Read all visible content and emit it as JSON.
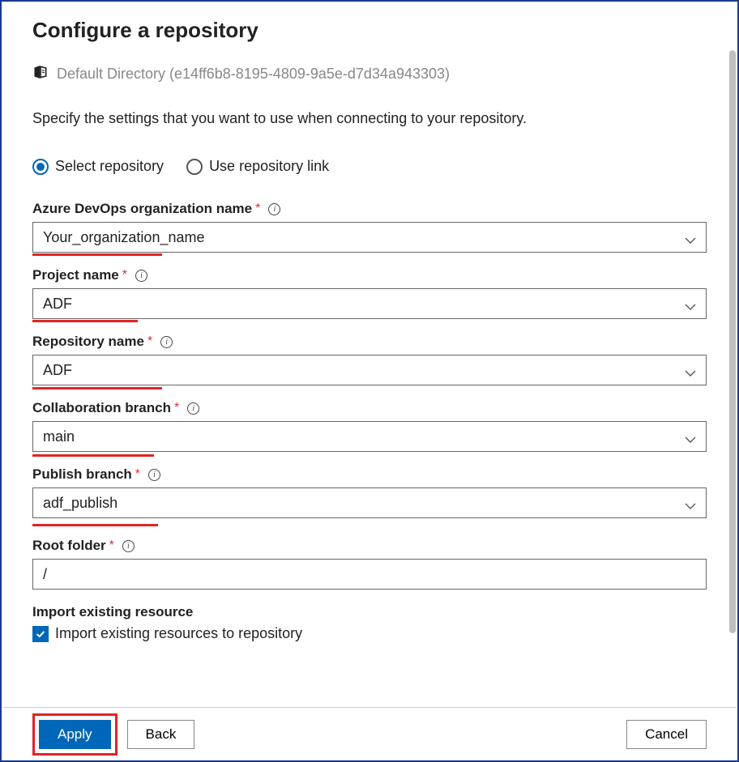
{
  "header": {
    "title": "Configure a repository",
    "breadcrumb": "Default Directory (e14ff6b8-8195-4809-9a5e-d7d34a943303)",
    "description": "Specify the settings that you want to use when connecting to your repository."
  },
  "radio": {
    "select_repository": "Select repository",
    "use_link": "Use repository link"
  },
  "fields": {
    "org": {
      "label": "Azure DevOps organization name",
      "value": "Your_organization_name"
    },
    "project": {
      "label": "Project name",
      "value": "ADF"
    },
    "repo": {
      "label": "Repository name",
      "value": "ADF"
    },
    "collab": {
      "label": "Collaboration branch",
      "value": "main"
    },
    "publish": {
      "label": "Publish branch",
      "value": "adf_publish"
    },
    "root": {
      "label": "Root folder",
      "value": "/"
    }
  },
  "import": {
    "heading": "Import existing resource",
    "checkbox_label": "Import existing resources to repository"
  },
  "buttons": {
    "apply": "Apply",
    "back": "Back",
    "cancel": "Cancel"
  }
}
